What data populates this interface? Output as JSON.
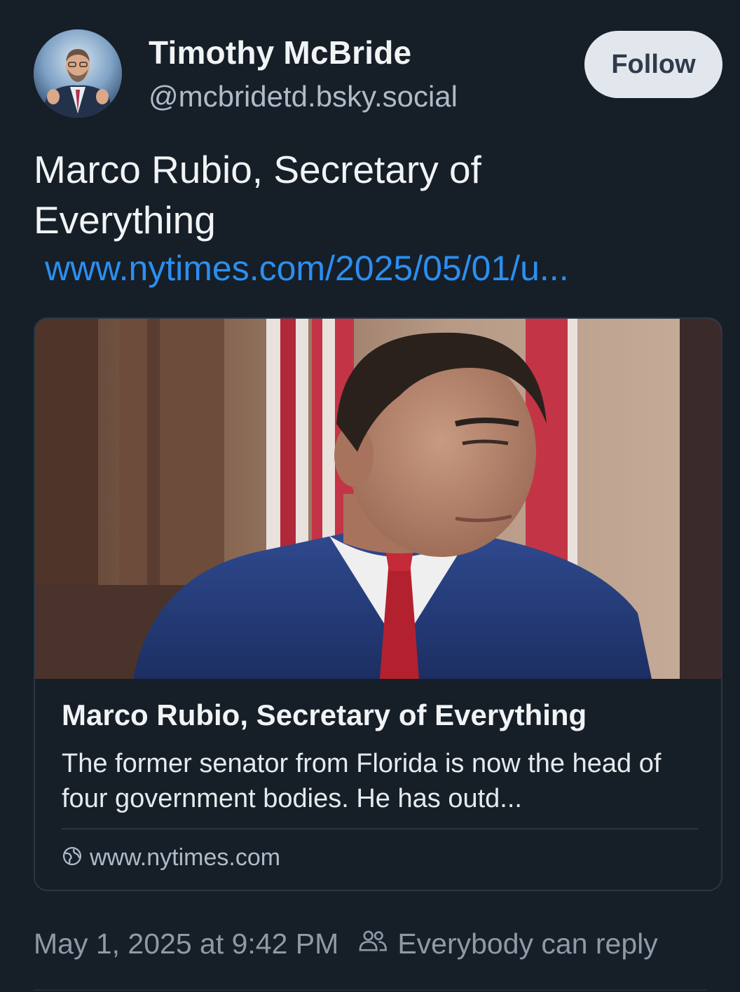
{
  "author": {
    "name": "Timothy McBride",
    "handle": "@mcbridetd.bsky.social"
  },
  "follow_label": "Follow",
  "post": {
    "text": "Marco Rubio, Secretary of Everything",
    "link": "www.nytimes.com/2025/05/01/u..."
  },
  "embed": {
    "title": "Marco Rubio, Secretary of Everything",
    "description": "The former senator from Florida is now the head of four government bodies. He has outd...",
    "domain": "www.nytimes.com"
  },
  "footer": {
    "timestamp": "May 1, 2025 at 9:42 PM",
    "reply_setting": "Everybody can reply"
  },
  "colors": {
    "background": "#161e27",
    "link": "#2b8ff0",
    "follow_button": "#e2e7ee",
    "muted_text": "#8e9aa8"
  },
  "icons": [
    "avatar-photo",
    "globe-icon",
    "people-icon"
  ]
}
